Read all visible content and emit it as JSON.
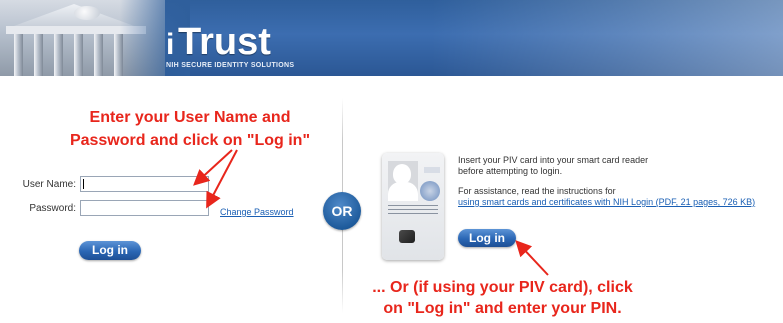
{
  "header": {
    "brand_name": "Trust",
    "brand_glyph": "i",
    "tagline": "NIH SECURE IDENTITY SOLUTIONS"
  },
  "annotations": {
    "left_line1": "Enter your User Name and",
    "left_line2": "Password and click on \"Log in\"",
    "right_line1": "... Or (if using your PIV card), click",
    "right_line2": "on \"Log in\" and enter your PIN."
  },
  "login_form": {
    "username_label": "User Name:",
    "username_value": "",
    "password_label": "Password:",
    "password_value": "",
    "change_password_link": "Change Password",
    "login_button": "Log in"
  },
  "separator": {
    "label": "OR"
  },
  "piv": {
    "instruction_line1": "Insert your PIV card into your smart card reader",
    "instruction_line2": "before attempting to login.",
    "assist_text": "For assistance, read the instructions for",
    "assist_link": "using smart cards and certificates with NIH Login (PDF, 21 pages, 726 KB)",
    "login_button": "Log in"
  },
  "colors": {
    "annotation_red": "#e8261c",
    "banner_blue": "#2f5f9c",
    "button_blue": "#2a66b4",
    "link_blue": "#1a5fb4"
  },
  "icons": {
    "card": "piv-card-icon",
    "badge": "or-badge"
  }
}
